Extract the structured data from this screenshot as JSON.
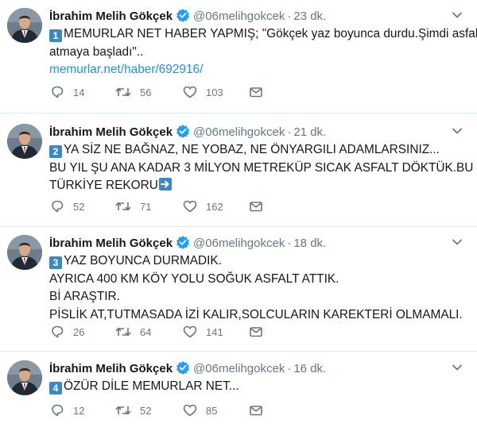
{
  "tweets": [
    {
      "name": "İbrahim Melih Gökçek",
      "handle": "@06melihgokcek",
      "separator": "·",
      "time": "23 dk.",
      "keycap": "1",
      "lines": [
        "MEMURLAR NET HABER YAPMIŞ; \"Gökçek yaz boyunca durdu.Şimdi asfalt",
        "atmaya başladı\"..",
        "memurlar.net/haber/692916/"
      ],
      "replies": "14",
      "retweets": "56",
      "likes": "103"
    },
    {
      "name": "İbrahim Melih Gökçek",
      "handle": "@06melihgokcek",
      "separator": "·",
      "time": "21 dk.",
      "keycap": "2",
      "lines": [
        "YA SİZ NE BAĞNAZ, NE YOBAZ, NE ÖNYARGILI ADAMLARSINIZ...",
        "BU YIL ŞU ANA KADAR 3 MİLYON METREKÜP SICAK ASFALT DÖKTÜK.BU",
        "TÜRKİYE REKORU"
      ],
      "replies": "52",
      "retweets": "71",
      "likes": "162"
    },
    {
      "name": "İbrahim Melih Gökçek",
      "handle": "@06melihgokcek",
      "separator": "·",
      "time": "18 dk.",
      "keycap": "3",
      "lines": [
        "YAZ BOYUNCA DURMADIK.",
        "AYRICA 400 KM KÖY YOLU SOĞUK ASFALT ATTIK.",
        "Bİ ARAŞTIR.",
        "PİSLİK AT,TUTMASADA İZİ KALIR,SOLCULARIN KAREKTERİ OLMAMALI."
      ],
      "replies": "26",
      "retweets": "64",
      "likes": "141"
    },
    {
      "name": "İbrahim Melih Gökçek",
      "handle": "@06melihgokcek",
      "separator": "·",
      "time": "16 dk.",
      "keycap": "4",
      "lines": [
        "ÖZÜR DİLE MEMURLAR NET..."
      ],
      "replies": "12",
      "retweets": "52",
      "likes": "85"
    }
  ],
  "colors": {
    "text": "#14171a",
    "secondary": "#657786",
    "link": "#1b95e0",
    "verified": "#1da1f2",
    "keycap": "#3b88c3",
    "divider": "#e1e8ed"
  },
  "icons": {
    "reply": "reply-icon",
    "retweet": "retweet-icon",
    "like": "heart-icon",
    "dm": "envelope-icon",
    "caret": "chevron-down-icon",
    "verified": "verified-badge-icon"
  }
}
